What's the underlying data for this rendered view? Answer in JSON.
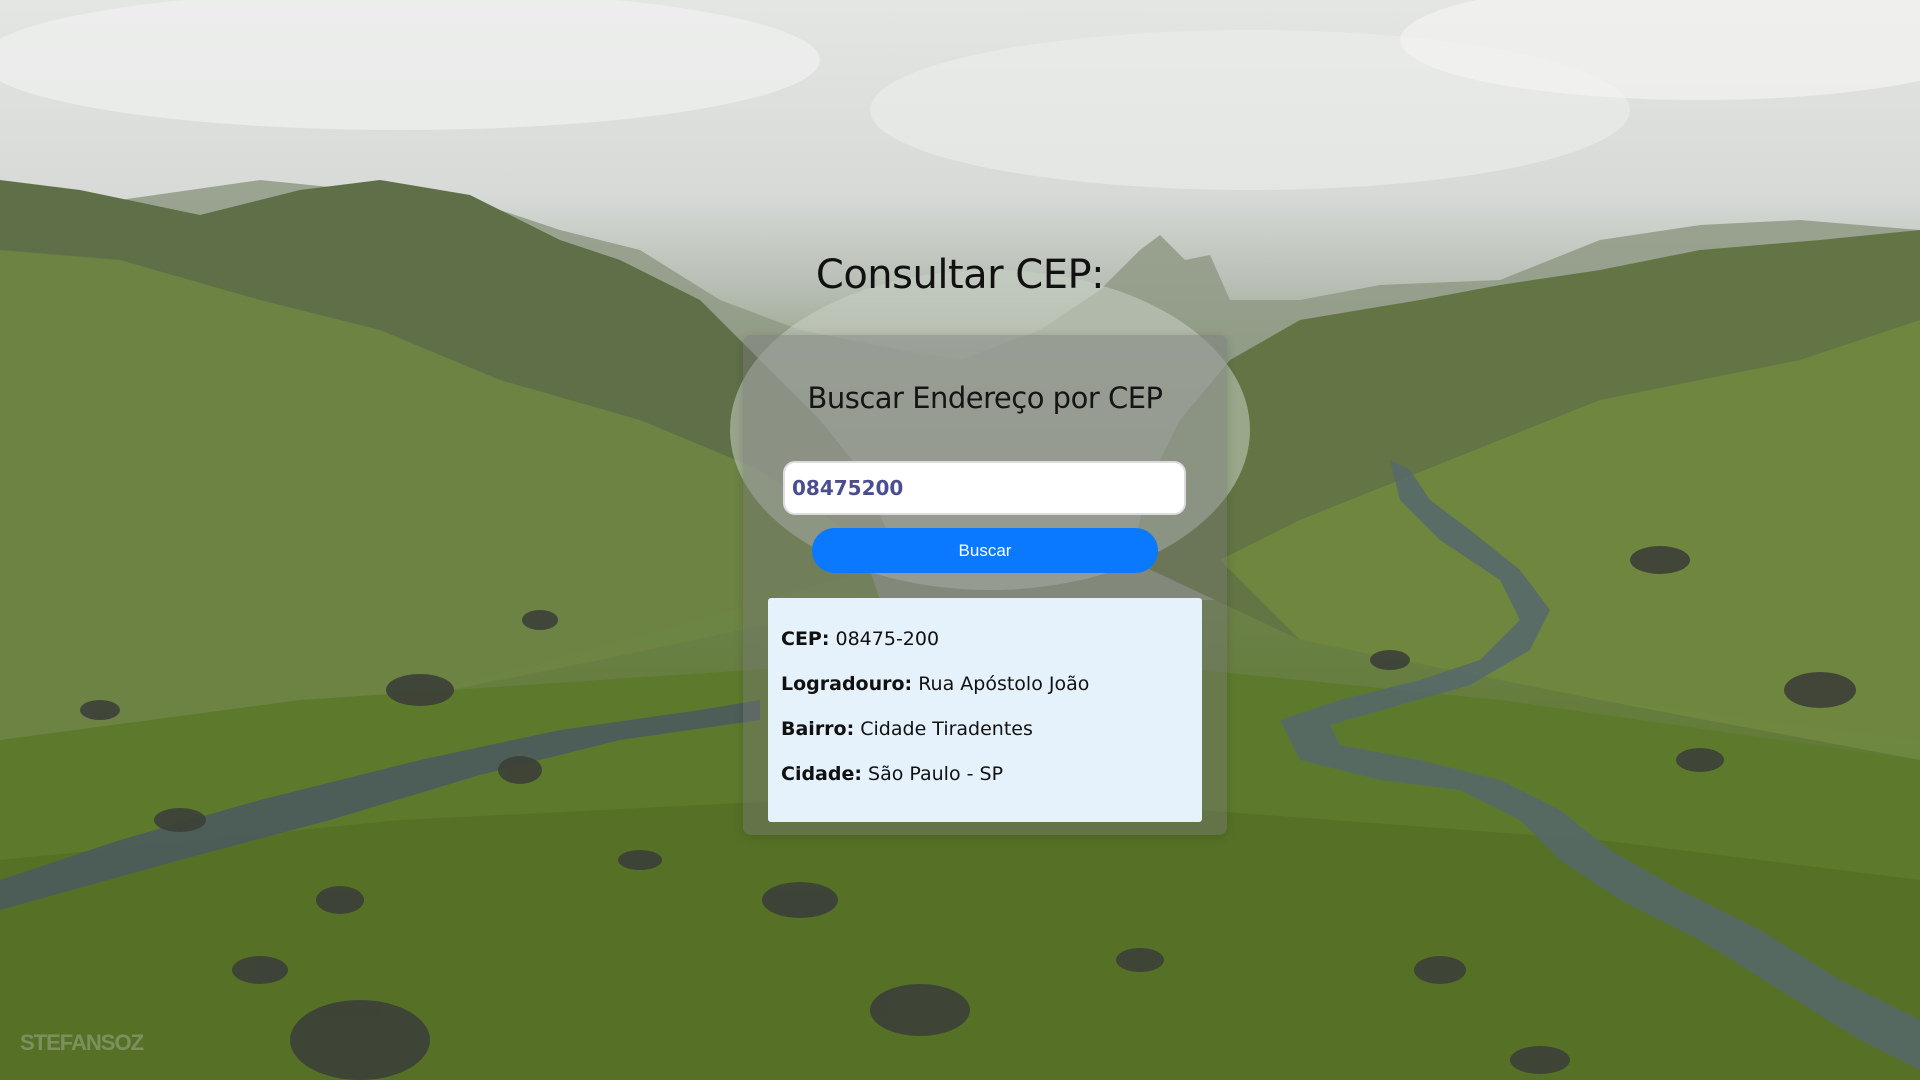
{
  "page": {
    "title": "Consultar CEP:",
    "watermark": "STEFANSOZ"
  },
  "card": {
    "title": "Buscar Endereço por CEP",
    "cep_input_value": "08475200",
    "search_button_label": "Buscar"
  },
  "result": {
    "rows": [
      {
        "label": "CEP:",
        "value": "08475-200"
      },
      {
        "label": "Logradouro:",
        "value": "Rua Apóstolo João"
      },
      {
        "label": "Bairro:",
        "value": "Cidade Tiradentes"
      },
      {
        "label": "Cidade:",
        "value": "São Paulo - SP"
      }
    ]
  },
  "colors": {
    "button": "#0a78ff",
    "input_text": "#4a4e8f",
    "result_background": "#e5f1fb"
  },
  "background": {
    "description_icon": "mountain-landscape"
  }
}
